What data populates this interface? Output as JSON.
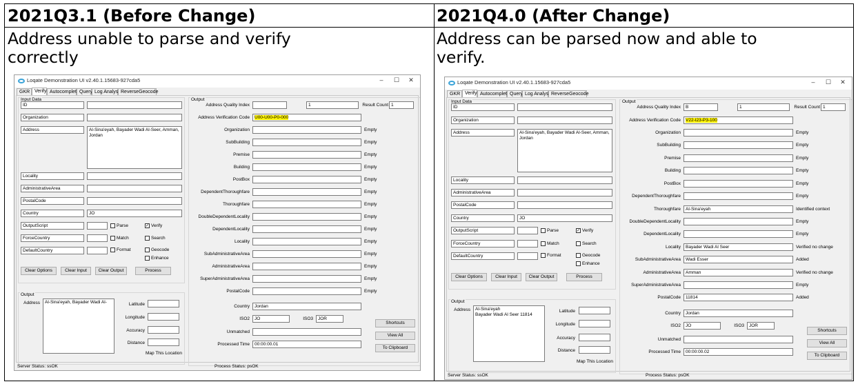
{
  "columns": [
    {
      "header": "2021Q3.1 (Before Change)",
      "desc": [
        "Address unable to parse and verify",
        "correctly"
      ]
    },
    {
      "header": "2021Q4.0 (After Change)",
      "desc": [
        "Address can be parsed now and able to",
        "verify."
      ]
    }
  ],
  "window": {
    "title": "Loqate Demonstration UI v2.40.1.15683-927cda5",
    "tabs": [
      "GKR",
      "Verify",
      "Autocomplete",
      "Query",
      "Log Analysis",
      "ReverseGeocode"
    ],
    "active_tab": "Verify",
    "input_data_label": "Input Data",
    "output_label": "Output",
    "input_rows": [
      {
        "field": "ID",
        "value": ""
      },
      {
        "field": "Organization",
        "value": ""
      },
      {
        "field": "Address",
        "value": "Al-Sina'eyah, Bayader Wadi Al-Seer, Amman, Jordan"
      },
      {
        "field": "Locality",
        "value": ""
      },
      {
        "field": "AdministrativeArea",
        "value": ""
      },
      {
        "field": "PostalCode",
        "value": ""
      },
      {
        "field": "Country",
        "value": "JO"
      },
      {
        "field": "OutputScript",
        "value": ""
      },
      {
        "field": "ForceCountry",
        "value": ""
      },
      {
        "field": "DefaultCountry",
        "value": ""
      }
    ],
    "options": [
      "Parse",
      "Match",
      "Format",
      "Verify",
      "Search",
      "Geocode",
      "Enhance"
    ],
    "buttons": {
      "clear_options": "Clear Options",
      "clear_input": "Clear Input",
      "clear_output": "Clear Output",
      "process": "Process"
    },
    "geo_labels": {
      "address": "Address",
      "latitude": "Latitude",
      "longitude": "Longitude",
      "accuracy": "Accuracy",
      "distance": "Distance",
      "map": "Map This Location"
    },
    "aqi_label": "Address Quality Index",
    "result_count_label": "Result Count",
    "avc_label": "Address Verification Code",
    "iso2_label": "ISO2",
    "iso3_label": "ISO3",
    "unmatched_label": "Unmatched",
    "processed_label": "Processed Time",
    "side_buttons": [
      "Shortcuts",
      "View All",
      "To Clipboard"
    ],
    "server_status": "Server Status: ssOK",
    "process_status": "Process Status: psOK",
    "output_field_labels": [
      "Organization",
      "SubBuilding",
      "Premise",
      "Building",
      "PostBox",
      "DependentThoroughfare",
      "Thoroughfare",
      "DoubleDependentLocality",
      "DependentLocality",
      "Locality",
      "SubAdministrativeArea",
      "AdministrativeArea",
      "SuperAdministrativeArea",
      "PostalCode"
    ]
  },
  "before": {
    "aqi": "",
    "result_index": "1",
    "result_count": "1",
    "avc": "U00-U00-P0-000",
    "values": [
      "",
      "",
      "",
      "",
      "",
      "",
      "",
      "",
      "",
      "",
      "",
      "",
      "",
      ""
    ],
    "statuses": [
      "Empty",
      "Empty",
      "Empty",
      "Empty",
      "Empty",
      "Empty",
      "Empty",
      "Empty",
      "Empty",
      "Empty",
      "Empty",
      "Empty",
      "Empty",
      "Empty"
    ],
    "country": "Jordan",
    "iso2": "JO",
    "iso3": "JOR",
    "unmatched": "",
    "processed_time": "00:00:00.01",
    "geo_address": "Al-Sina'eyah, Bayader Wadi Al-"
  },
  "after": {
    "aqi": "B",
    "result_index": "1",
    "result_count": "1",
    "avc": "V22-I23-P3-100",
    "values": [
      "",
      "",
      "",
      "",
      "",
      "",
      "Al-Sina'eyah",
      "",
      "",
      "Bayader Wadi Al Seer",
      "Wadi Esser",
      "Amman",
      "",
      "11814"
    ],
    "statuses": [
      "Empty",
      "Empty",
      "Empty",
      "Empty",
      "Empty",
      "Empty",
      "Identified context",
      "Empty",
      "Empty",
      "Verified no change",
      "Added",
      "Verified no change",
      "Empty",
      "Added"
    ],
    "country": "Jordan",
    "iso2": "JO",
    "iso3": "JOR",
    "unmatched": "",
    "processed_time": "00:00:00.02",
    "geo_address": "Al-Sina'eyah\nBayader Wadi Al Seer 11814"
  }
}
